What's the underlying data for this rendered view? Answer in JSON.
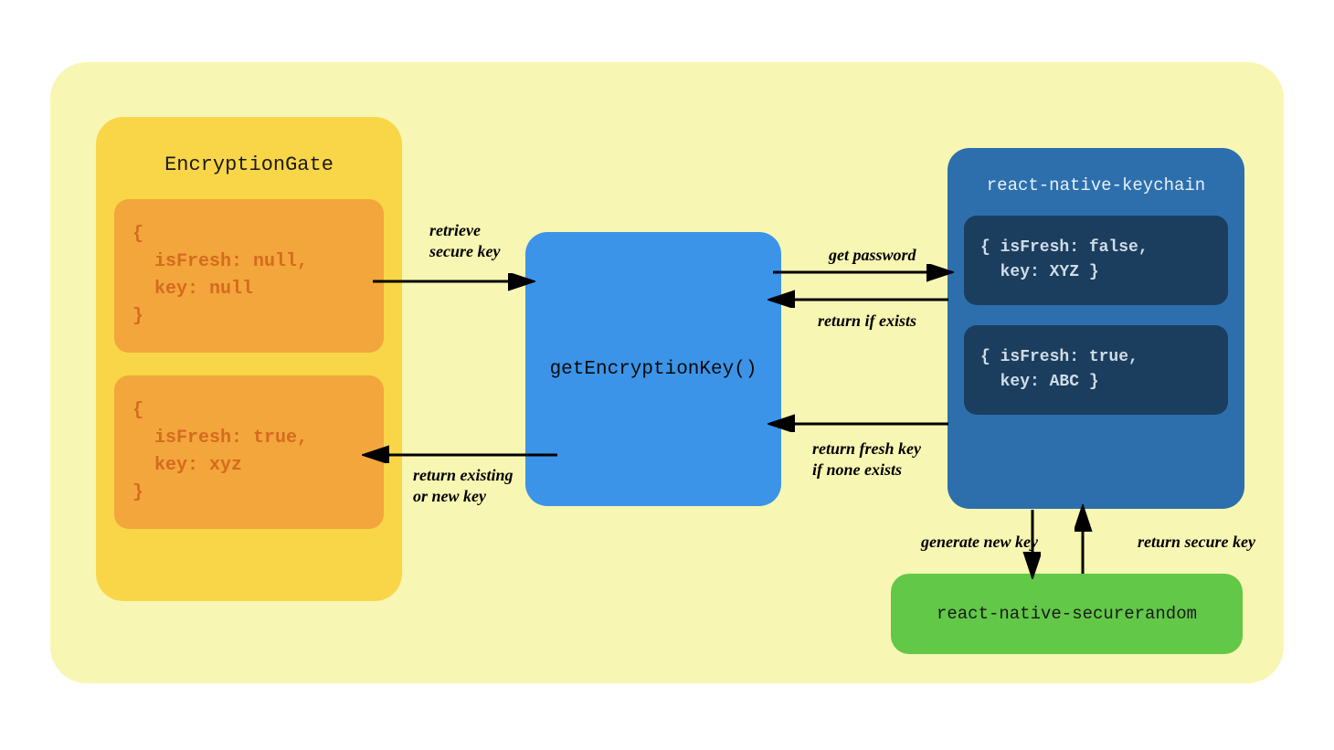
{
  "encryptionGate": {
    "title": "EncryptionGate",
    "block1": "{\n  isFresh: null,\n  key: null\n}",
    "block2": "{\n  isFresh: true,\n  key: xyz\n}"
  },
  "center": {
    "label": "getEncryptionKey()"
  },
  "keychain": {
    "title": "react-native-keychain",
    "block1": "{ isFresh: false,\n  key: XYZ }",
    "block2": "{ isFresh: true,\n  key: ABC }"
  },
  "securerandom": {
    "label": "react-native-securerandom"
  },
  "labels": {
    "retrieve": "retrieve\nsecure key",
    "returnExisting": "return existing\nor new key",
    "getPassword": "get password",
    "returnIfExists": "return if exists",
    "returnFresh": "return fresh key\nif none exists",
    "generateNewKey": "generate new key",
    "returnSecureKey": "return secure key"
  }
}
